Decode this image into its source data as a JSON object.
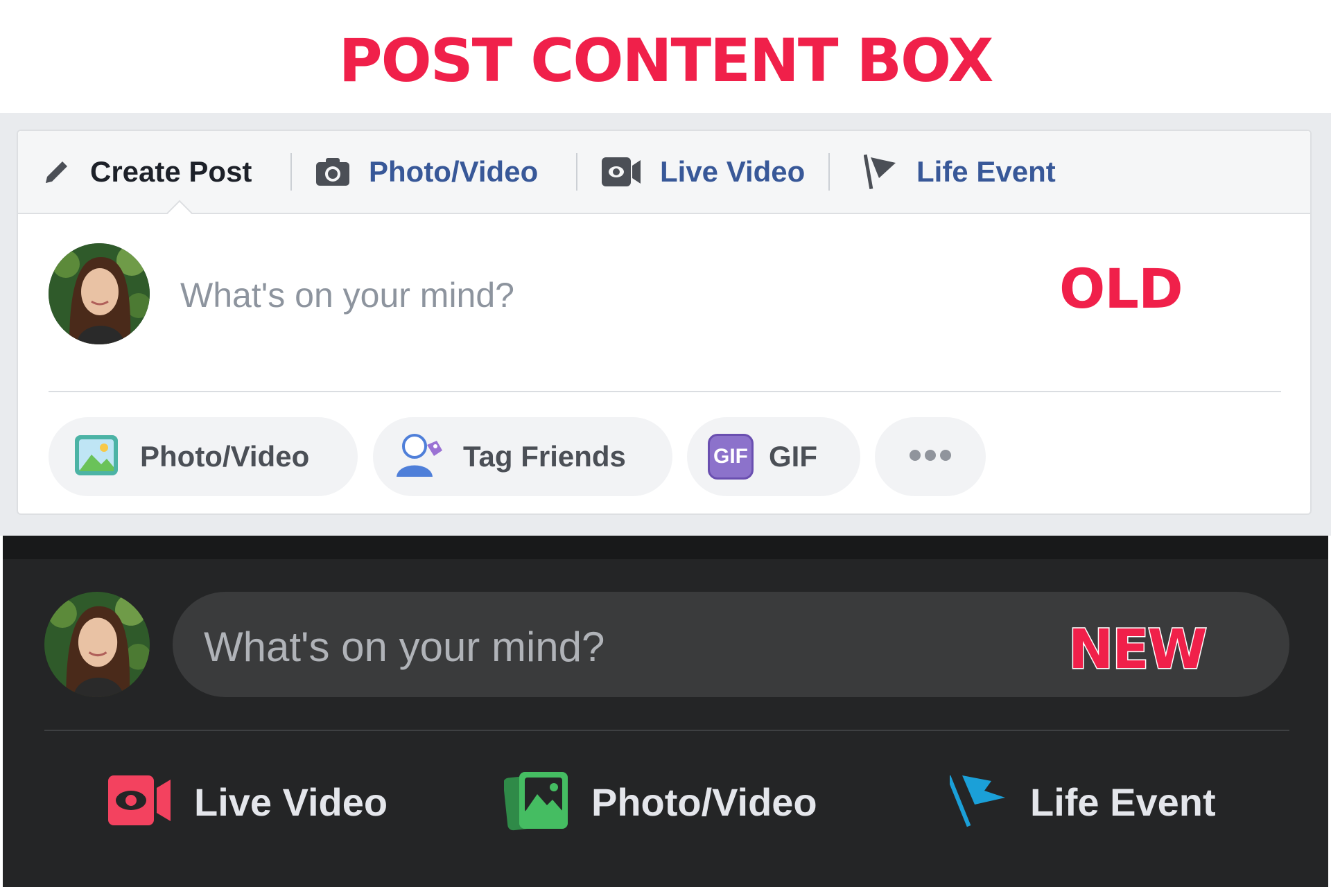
{
  "title": "POST CONTENT BOX",
  "old": {
    "tag": "OLD",
    "tabs": [
      {
        "label": "Create Post",
        "icon": "pencil-icon"
      },
      {
        "label": "Photo/Video",
        "icon": "camera-icon"
      },
      {
        "label": "Live Video",
        "icon": "video-camera-icon"
      },
      {
        "label": "Life Event",
        "icon": "flag-icon"
      }
    ],
    "placeholder": "What's on your mind?",
    "actions": [
      {
        "label": "Photo/Video",
        "icon": "photo-icon"
      },
      {
        "label": "Tag Friends",
        "icon": "tag-friends-icon"
      },
      {
        "label": "GIF",
        "icon": "gif-icon",
        "icon_text": "GIF"
      },
      {
        "label": "",
        "icon": "more-icon"
      }
    ]
  },
  "new": {
    "tag": "NEW",
    "placeholder": "What's on your mind?",
    "actions": [
      {
        "label": "Live Video",
        "icon": "live-video-icon",
        "color": "#f3425f"
      },
      {
        "label": "Photo/Video",
        "icon": "photo-video-icon",
        "color": "#45bd62"
      },
      {
        "label": "Life Event",
        "icon": "life-event-flag-icon",
        "color": "#1ba0d8"
      }
    ]
  },
  "colors": {
    "accent": "#f0204a",
    "link_blue": "#385898",
    "dark_bg": "#242526",
    "dark_input": "#3a3b3c"
  }
}
